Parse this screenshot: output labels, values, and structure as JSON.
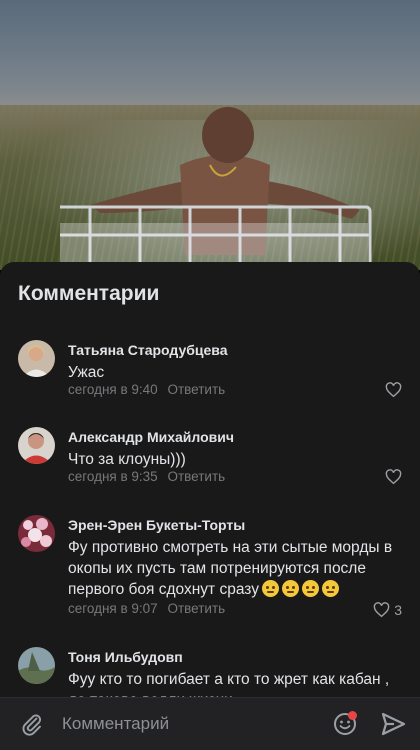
{
  "comments_panel": {
    "title": "Комментарии",
    "comments": [
      {
        "author": "Татьяна Стародубцева",
        "text": "Ужас",
        "time": "сегодня в 9:40",
        "reply_label": "Ответить",
        "likes": ""
      },
      {
        "author": "Александр Михайлович",
        "text": "Что за клоуны)))",
        "time": "сегодня в 9:35",
        "reply_label": "Ответить",
        "likes": ""
      },
      {
        "author": "Эрен-Эрен Букеты-Торты",
        "text": "Фу противно смотреть на эти сытые морды в окопы их пусть там потренируются после первого боя сдохнут сразу",
        "time": "сегодня в 9:07",
        "reply_label": "Ответить",
        "likes": "3"
      },
      {
        "author": "Тоня Ильбудовп",
        "text": "Фуу кто то погибает а кто то жрет как кабан , до такова ведли жизни",
        "time": "",
        "reply_label": "",
        "likes": ""
      }
    ]
  },
  "composer": {
    "placeholder": "Комментарий"
  },
  "icons": [
    "attach-icon",
    "sticker-icon",
    "send-icon",
    "heart-icon"
  ],
  "colors": {
    "sheet_bg": "#19191a",
    "composer_bg": "#222224",
    "text": "#e1e3e6",
    "meta": "#76787a",
    "accent": "#2a8dff",
    "badge": "#e64646"
  }
}
